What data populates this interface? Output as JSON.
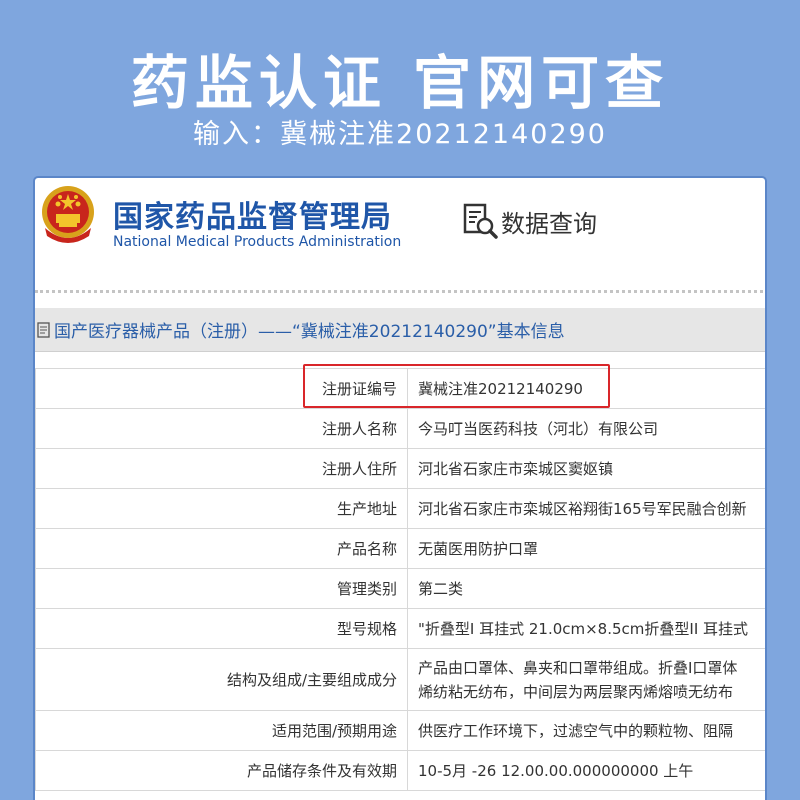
{
  "banner": {
    "title": "药监认证  官网可查",
    "subtitle": "输入：冀械注准20212140290"
  },
  "site": {
    "org_name_cn": "国家药品监督管理局",
    "org_name_en": "National Medical Products Administration",
    "query_label": "数据查询",
    "query_icon": "document-search-icon",
    "emblem_icon": "national-emblem-icon"
  },
  "section": {
    "title": "国产医疗器械产品（注册）——“冀械注准20212140290”基本信息"
  },
  "rows": [
    {
      "label": "注册证编号",
      "value": "冀械注准20212140290"
    },
    {
      "label": "注册人名称",
      "value": "今马叮当医药科技（河北）有限公司"
    },
    {
      "label": "注册人住所",
      "value": "河北省石家庄市栾城区窦妪镇"
    },
    {
      "label": "生产地址",
      "value": "河北省石家庄市栾城区裕翔街165号军民融合创新"
    },
    {
      "label": "产品名称",
      "value": "无菌医用防护口罩"
    },
    {
      "label": "管理类别",
      "value": "第二类"
    },
    {
      "label": "型号规格",
      "value": "\"折叠型I 耳挂式 21.0cm×8.5cm折叠型II 耳挂式"
    },
    {
      "label": "结构及组成/主要组成成分",
      "value_line1": "产品由口罩体、鼻夹和口罩带组成。折叠I口罩体",
      "value_line2": "烯纺粘无纺布，中间层为两层聚丙烯熔喷无纺布"
    },
    {
      "label": "适用范围/预期用途",
      "value": "供医疗工作环境下，过滤空气中的颗粒物、阻隔"
    },
    {
      "label": "产品储存条件及有效期",
      "value": "10-5月 -26 12.00.00.000000000 上午"
    }
  ],
  "colors": {
    "background": "#7fa6de",
    "brand_blue": "#1f56a8",
    "highlight_red": "#d9262a"
  }
}
